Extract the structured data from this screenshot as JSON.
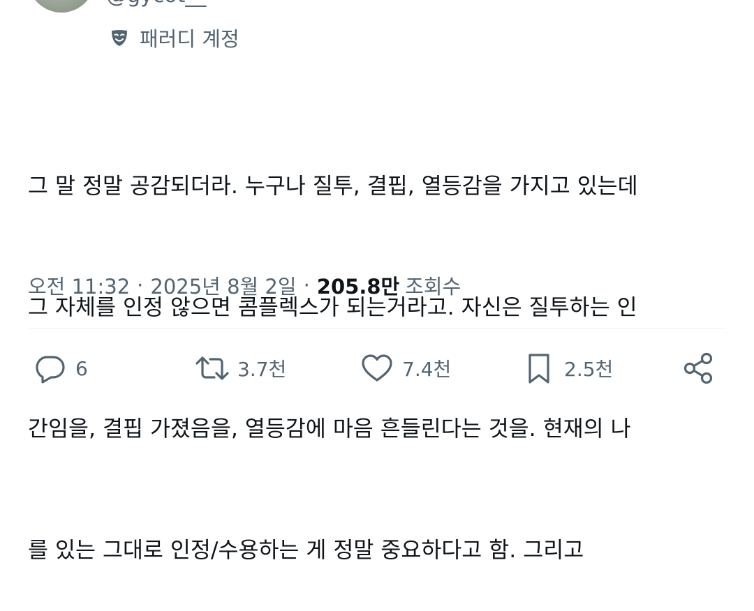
{
  "author": {
    "handle": "@gycot__",
    "account_label": "패러디 계정",
    "account_icon": "parody-mask-icon"
  },
  "tweet": {
    "lines": [
      "그 말 정말 공감되더라. 누구나 질투, 결핍, 열등감을 가지고 있는데",
      "그 자체를 인정 않으면 콤플렉스가 되는거라고. 자신은 질투하는 인",
      "간임을, 결핍 가졌음을, 열등감에 마음 흔들린다는 것을. 현재의 나",
      "를 있는 그대로 인정/수용하는 게 정말 중요하다고 함. 그리고"
    ]
  },
  "meta": {
    "time": "오전 11:32",
    "separator": "·",
    "date": "2025년 8월 2일",
    "views_count": "205.8만",
    "views_label": "조회수"
  },
  "actions": {
    "reply": {
      "icon": "reply-icon",
      "count": "6"
    },
    "retweet": {
      "icon": "retweet-icon",
      "count": "3.7천"
    },
    "like": {
      "icon": "heart-icon",
      "count": "7.4천"
    },
    "bookmark": {
      "icon": "bookmark-icon",
      "count": "2.5천"
    },
    "share": {
      "icon": "share-icon"
    }
  },
  "colors": {
    "text_primary": "#0f1419",
    "text_secondary": "#536471",
    "divider": "#eff3f4"
  }
}
